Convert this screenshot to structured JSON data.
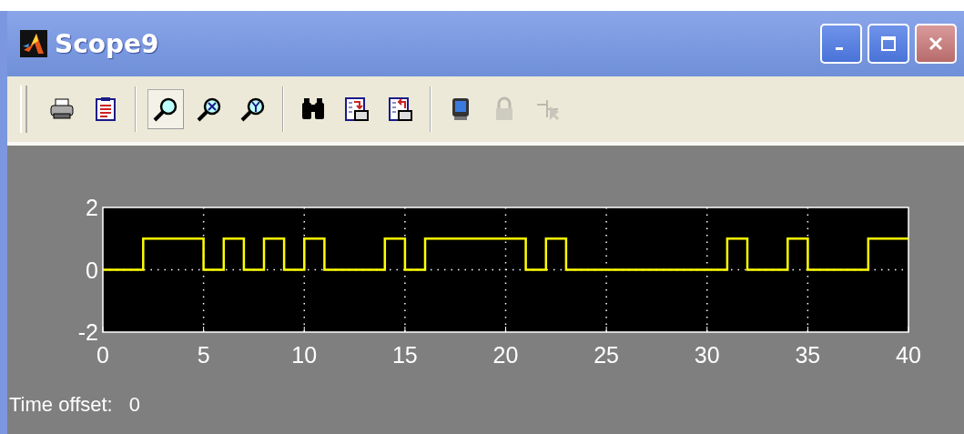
{
  "window": {
    "title": "Scope9",
    "controls": [
      {
        "kind": "minimize"
      },
      {
        "kind": "maximize"
      },
      {
        "kind": "close"
      }
    ]
  },
  "toolbar": [
    [
      {
        "kind": "print",
        "selected": false,
        "disabled": false
      },
      {
        "kind": "parameters",
        "selected": false,
        "disabled": false
      }
    ],
    [
      {
        "kind": "zoom",
        "selected": true,
        "disabled": false
      },
      {
        "kind": "zoom-x",
        "selected": false,
        "disabled": false
      },
      {
        "kind": "zoom-y",
        "selected": false,
        "disabled": false
      }
    ],
    [
      {
        "kind": "autoscale",
        "selected": false,
        "disabled": false
      },
      {
        "kind": "save-axes",
        "selected": false,
        "disabled": false
      },
      {
        "kind": "restore-axes",
        "selected": false,
        "disabled": false
      }
    ],
    [
      {
        "kind": "float",
        "selected": false,
        "disabled": false
      },
      {
        "kind": "lock",
        "selected": false,
        "disabled": true
      },
      {
        "kind": "signal-select",
        "selected": false,
        "disabled": true
      }
    ]
  ],
  "plot": {
    "chart_data": {
      "type": "line",
      "xlim": [
        0,
        40
      ],
      "ylim": [
        -2,
        2
      ],
      "xticks": [
        0,
        5,
        10,
        15,
        20,
        25,
        30,
        35,
        40
      ],
      "yticks": [
        -2,
        0,
        2
      ],
      "x": [
        0,
        2,
        2,
        5,
        5,
        6,
        6,
        7,
        7,
        8,
        8,
        9,
        9,
        10,
        10,
        11,
        11,
        14,
        14,
        15,
        15,
        16,
        16,
        21,
        21,
        22,
        22,
        23,
        23,
        31,
        31,
        32,
        32,
        34,
        34,
        35,
        35,
        38,
        38,
        40
      ],
      "grid": true,
      "series": [
        {
          "color": "#ffff00",
          "values": [
            0,
            0,
            1,
            1,
            0,
            0,
            1,
            1,
            0,
            0,
            1,
            1,
            0,
            0,
            1,
            1,
            0,
            0,
            1,
            1,
            0,
            0,
            1,
            1,
            0,
            0,
            1,
            1,
            0,
            0,
            1,
            1,
            0,
            0,
            1,
            1,
            0,
            0,
            1,
            1
          ]
        }
      ]
    }
  },
  "status": {
    "label": "Time offset:",
    "value": "0"
  }
}
